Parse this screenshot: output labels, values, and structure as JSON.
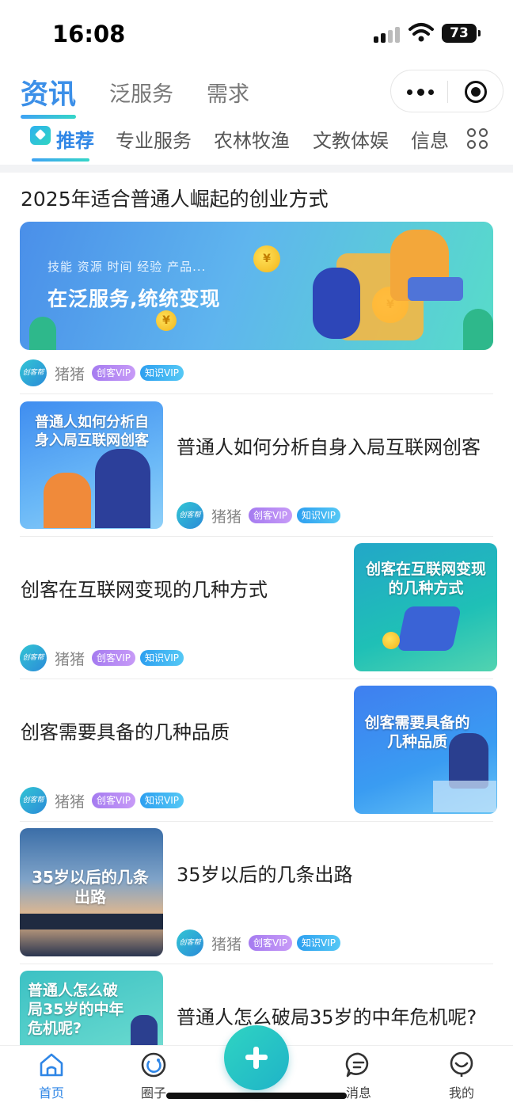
{
  "status_bar": {
    "time": "16:08",
    "battery": "73"
  },
  "header": {
    "tabs": [
      {
        "label": "资讯",
        "active": true
      },
      {
        "label": "泛服务",
        "active": false
      },
      {
        "label": "需求",
        "active": false
      }
    ]
  },
  "categories": {
    "items": [
      "推荐",
      "专业服务",
      "农林牧渔",
      "文教体娱",
      "信息"
    ],
    "active_index": 0
  },
  "feed": {
    "featured": {
      "title": "2025年适合普通人崛起的创业方式",
      "banner_small": "技能 资源 时间 经验 产品...",
      "banner_big": "在泛服务,统统变现",
      "author": "猪猪",
      "badges": [
        "创客VIP",
        "知识VIP"
      ],
      "avatar_text": "创客帮"
    },
    "items": [
      {
        "title": "普通人如何分析自身入局互联网创客",
        "thumb_text": "普通人如何分析自身入局互联网创客",
        "author": "猪猪",
        "badges": [
          "创客VIP",
          "知识VIP"
        ],
        "avatar_text": "创客帮"
      },
      {
        "title": "创客在互联网变现的几种方式",
        "thumb_text": "创客在互联网变现的几种方式",
        "author": "猪猪",
        "badges": [
          "创客VIP",
          "知识VIP"
        ],
        "avatar_text": "创客帮"
      },
      {
        "title": "创客需要具备的几种品质",
        "thumb_text": "创客需要具备的几种品质",
        "author": "猪猪",
        "badges": [
          "创客VIP",
          "知识VIP"
        ],
        "avatar_text": "创客帮"
      },
      {
        "title": "35岁以后的几条出路",
        "thumb_text": "35岁以后的几条出路",
        "author": "猪猪",
        "badges": [
          "创客VIP",
          "知识VIP"
        ],
        "avatar_text": "创客帮"
      },
      {
        "title": "普通人怎么破局35岁的中年危机呢?",
        "thumb_text": "普通人怎么破局35岁的中年危机呢?"
      }
    ]
  },
  "bottom_nav": {
    "items": [
      {
        "label": "首页",
        "icon": "home-icon",
        "active": true
      },
      {
        "label": "圈子",
        "icon": "circle-icon",
        "active": false
      },
      {
        "label": "消息",
        "icon": "message-icon",
        "active": false
      },
      {
        "label": "我的",
        "icon": "profile-icon",
        "active": false
      }
    ],
    "center_icon": "plus-icon"
  },
  "colors": {
    "accent": "#2f86e6",
    "teal": "#2fd4c2",
    "vip_purple": "#b18af3",
    "vip_blue": "#2d9ff0"
  }
}
